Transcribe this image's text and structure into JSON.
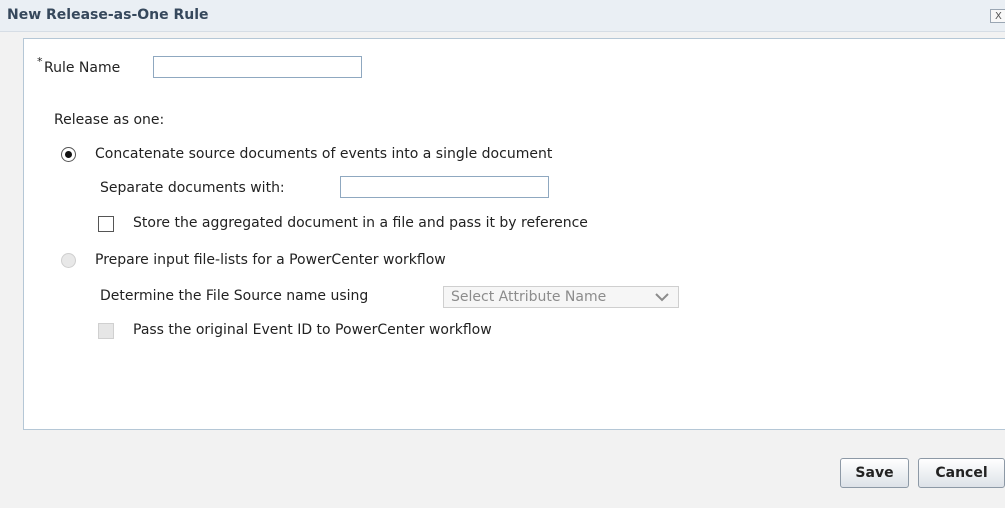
{
  "dialog": {
    "title": "New Release-as-One Rule",
    "close_label": "X"
  },
  "form": {
    "rule_name": {
      "required_mark": "*",
      "label": "Rule Name",
      "value": ""
    },
    "release_as_one_label": "Release as one:",
    "option_concatenate": {
      "label": "Concatenate source documents of events into a single document",
      "selected": true,
      "separator": {
        "label": "Separate documents with:",
        "value": ""
      },
      "store_by_reference": {
        "label": "Store the aggregated document in a file and pass it by reference",
        "checked": false
      }
    },
    "option_file_lists": {
      "label": "Prepare input file-lists for a PowerCenter workflow",
      "selected": false,
      "file_source": {
        "label": "Determine the File Source name using",
        "selected_value": "Select Attribute Name"
      },
      "pass_event_id": {
        "label": "Pass the original Event ID to PowerCenter workflow",
        "checked": false
      }
    }
  },
  "footer": {
    "save_label": "Save",
    "cancel_label": "Cancel"
  }
}
